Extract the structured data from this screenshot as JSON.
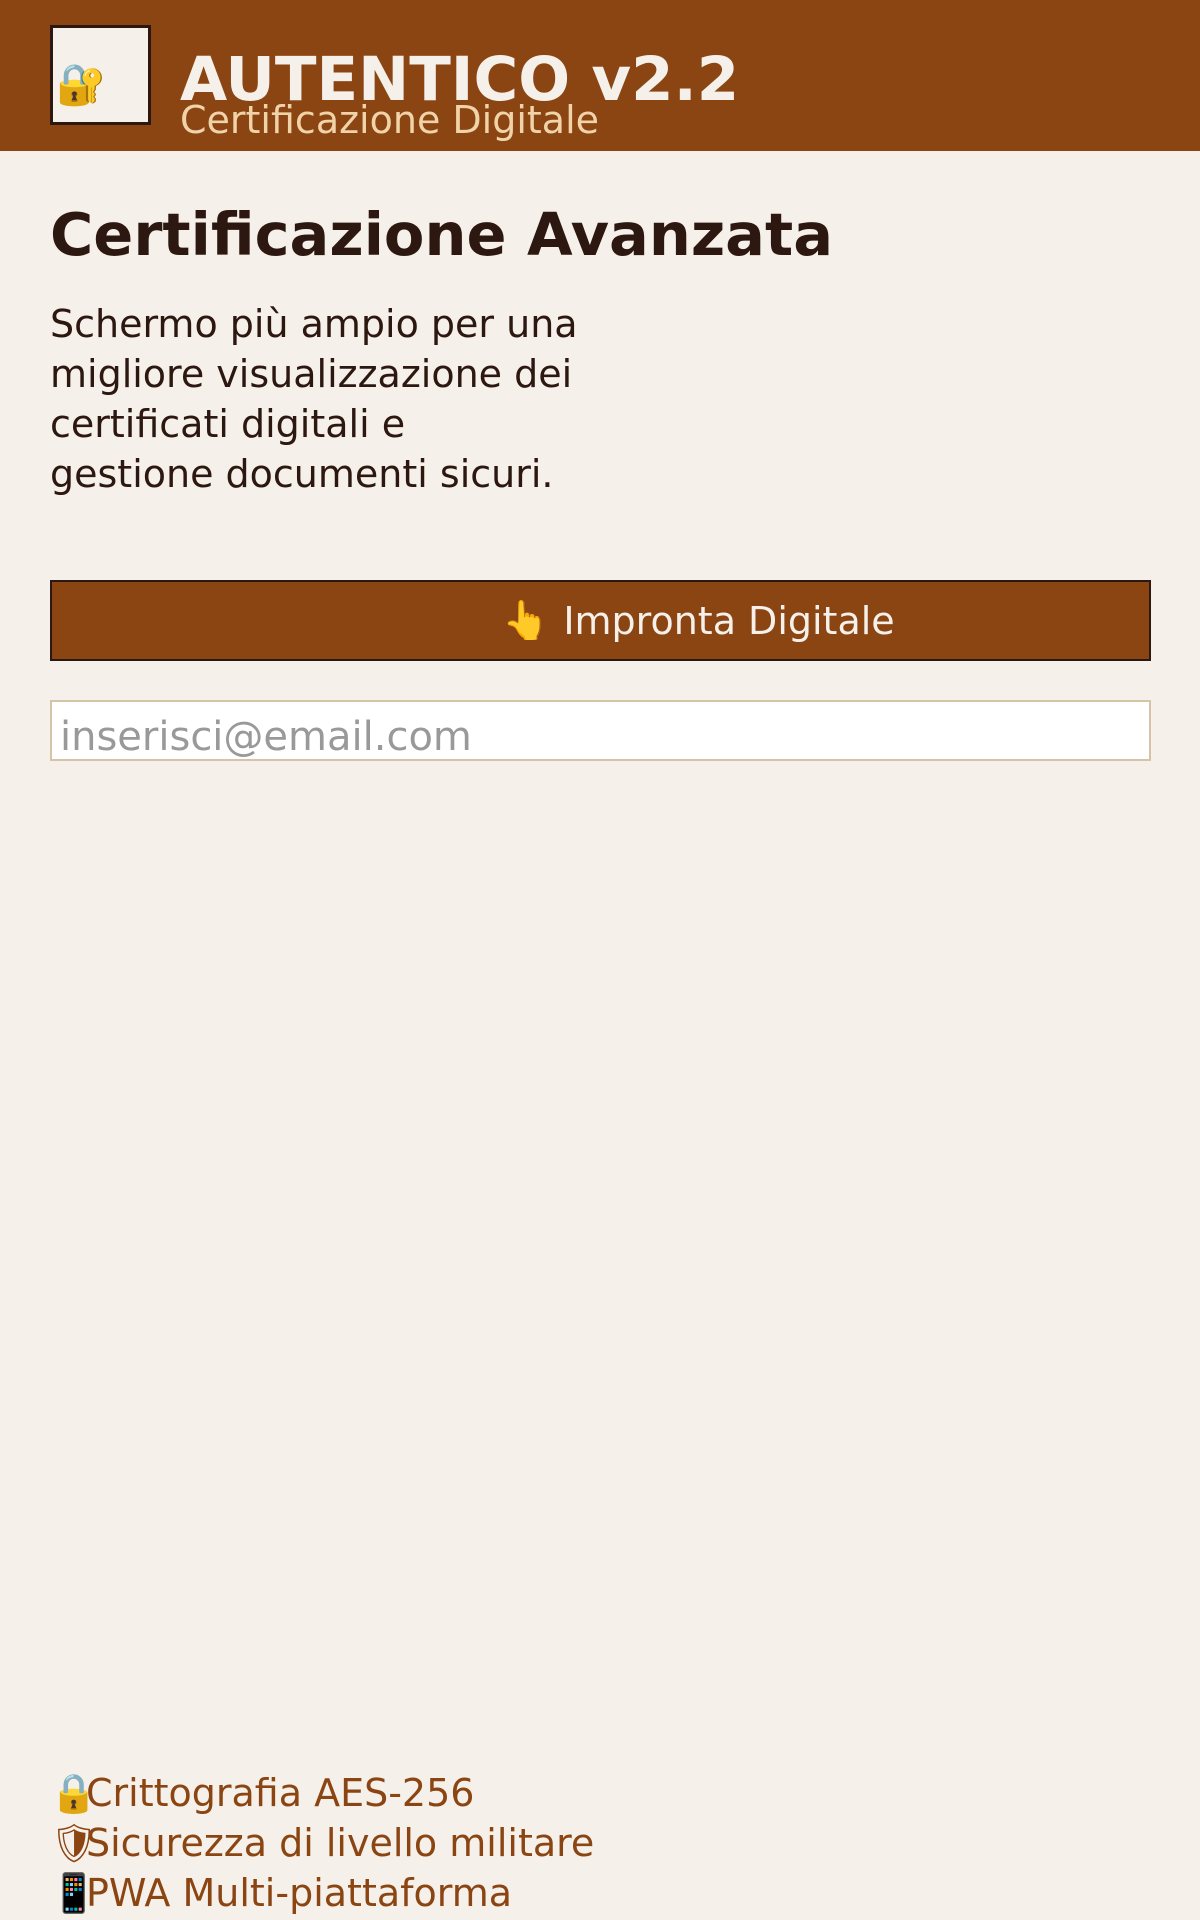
{
  "header": {
    "logo_icon": "certificate-icon",
    "logo_glyph": "🔐",
    "app_title": "AUTENTICO v2.2",
    "app_subtitle": "Certificazione Digitale"
  },
  "main": {
    "title": "Certificazione Avanzata",
    "description_lines": [
      "Schermo più ampio per una",
      "migliore visualizzazione dei",
      "certificati digitali e",
      "gestione documenti sicuri."
    ],
    "fingerprint_button": {
      "icon": "fingerprint-icon",
      "glyph": "👆",
      "label": "Impronta Digitale"
    },
    "email_input": {
      "value": "",
      "placeholder": "inserisci@email.com"
    }
  },
  "features": [
    {
      "icon": "lock-icon",
      "glyph": "🔒",
      "label": "Crittografia AES-256"
    },
    {
      "icon": "shield-icon",
      "glyph": "🛡",
      "label": "Sicurezza di livello militare"
    },
    {
      "icon": "devices-icon",
      "glyph": "📱",
      "label": "PWA Multi-piattaforma"
    }
  ],
  "colors": {
    "brand": "#8b4513",
    "background": "#f5f0e9",
    "text_dark": "#2c1810",
    "subtitle": "#f0d3a8"
  }
}
